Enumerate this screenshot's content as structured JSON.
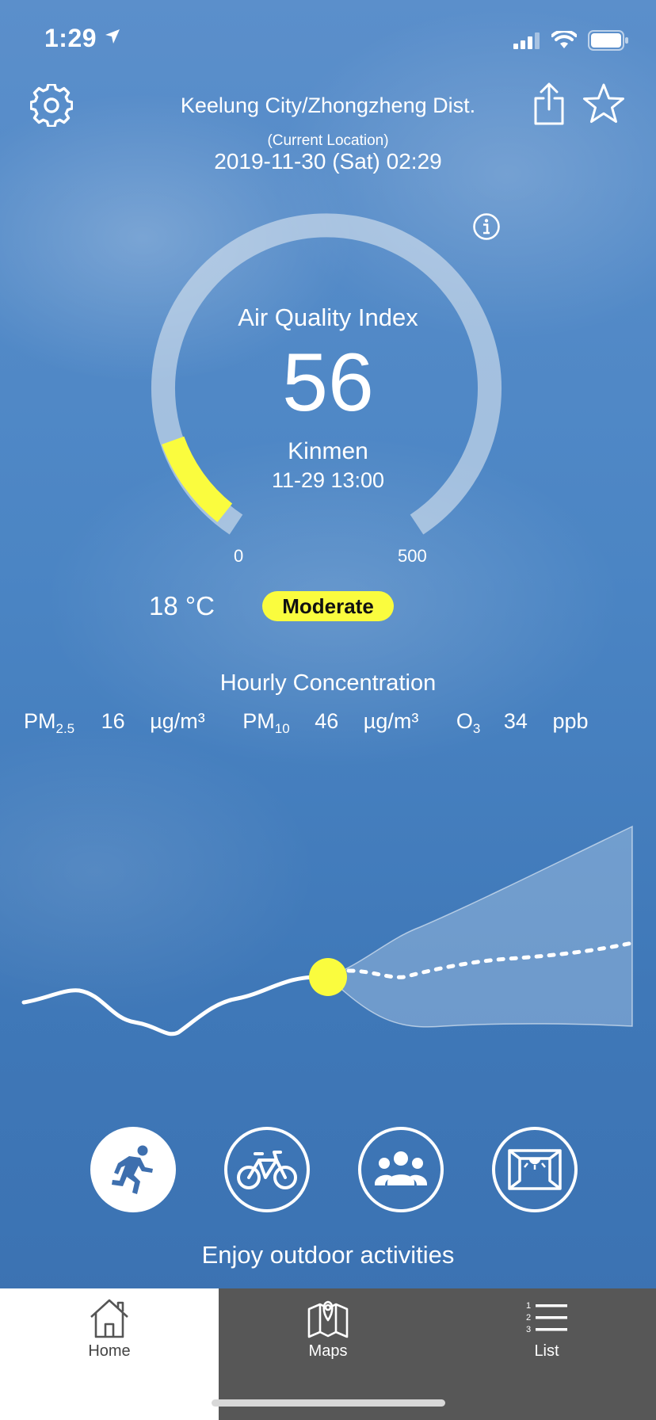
{
  "status_bar": {
    "time": "1:29"
  },
  "header": {
    "location": "Keelung City/Zhongzheng Dist.",
    "location_note": "(Current Location)",
    "datetime": "2019-11-30 (Sat) 02:29"
  },
  "aqi": {
    "label": "Air Quality Index",
    "value": "56",
    "station": "Kinmen",
    "station_time": "11-29 13:00",
    "scale_min": "0",
    "scale_max": "500",
    "level_fraction": 0.112
  },
  "weather": {
    "temperature": "18 °C"
  },
  "status": {
    "label": "Moderate",
    "color": "#fafc3e"
  },
  "hourly": {
    "title": "Hourly Concentration",
    "pm25": {
      "name": "PM",
      "sub": "2.5",
      "value": "16",
      "unit": "µg/m³"
    },
    "pm10": {
      "name": "PM",
      "sub": "10",
      "value": "46",
      "unit": "µg/m³"
    },
    "o3": {
      "name": "O",
      "sub": "3",
      "value": "34",
      "unit": "ppb"
    }
  },
  "activities": {
    "items": [
      "running-icon",
      "bicycle-icon",
      "group-icon",
      "window-icon"
    ],
    "message": "Enjoy outdoor activities"
  },
  "tabs": [
    {
      "label": "Home",
      "icon": "home-icon"
    },
    {
      "label": "Maps",
      "icon": "map-icon"
    },
    {
      "label": "List",
      "icon": "list-icon"
    }
  ],
  "colors": {
    "accent": "#fafc3e",
    "tab_inactive": "#575757"
  }
}
